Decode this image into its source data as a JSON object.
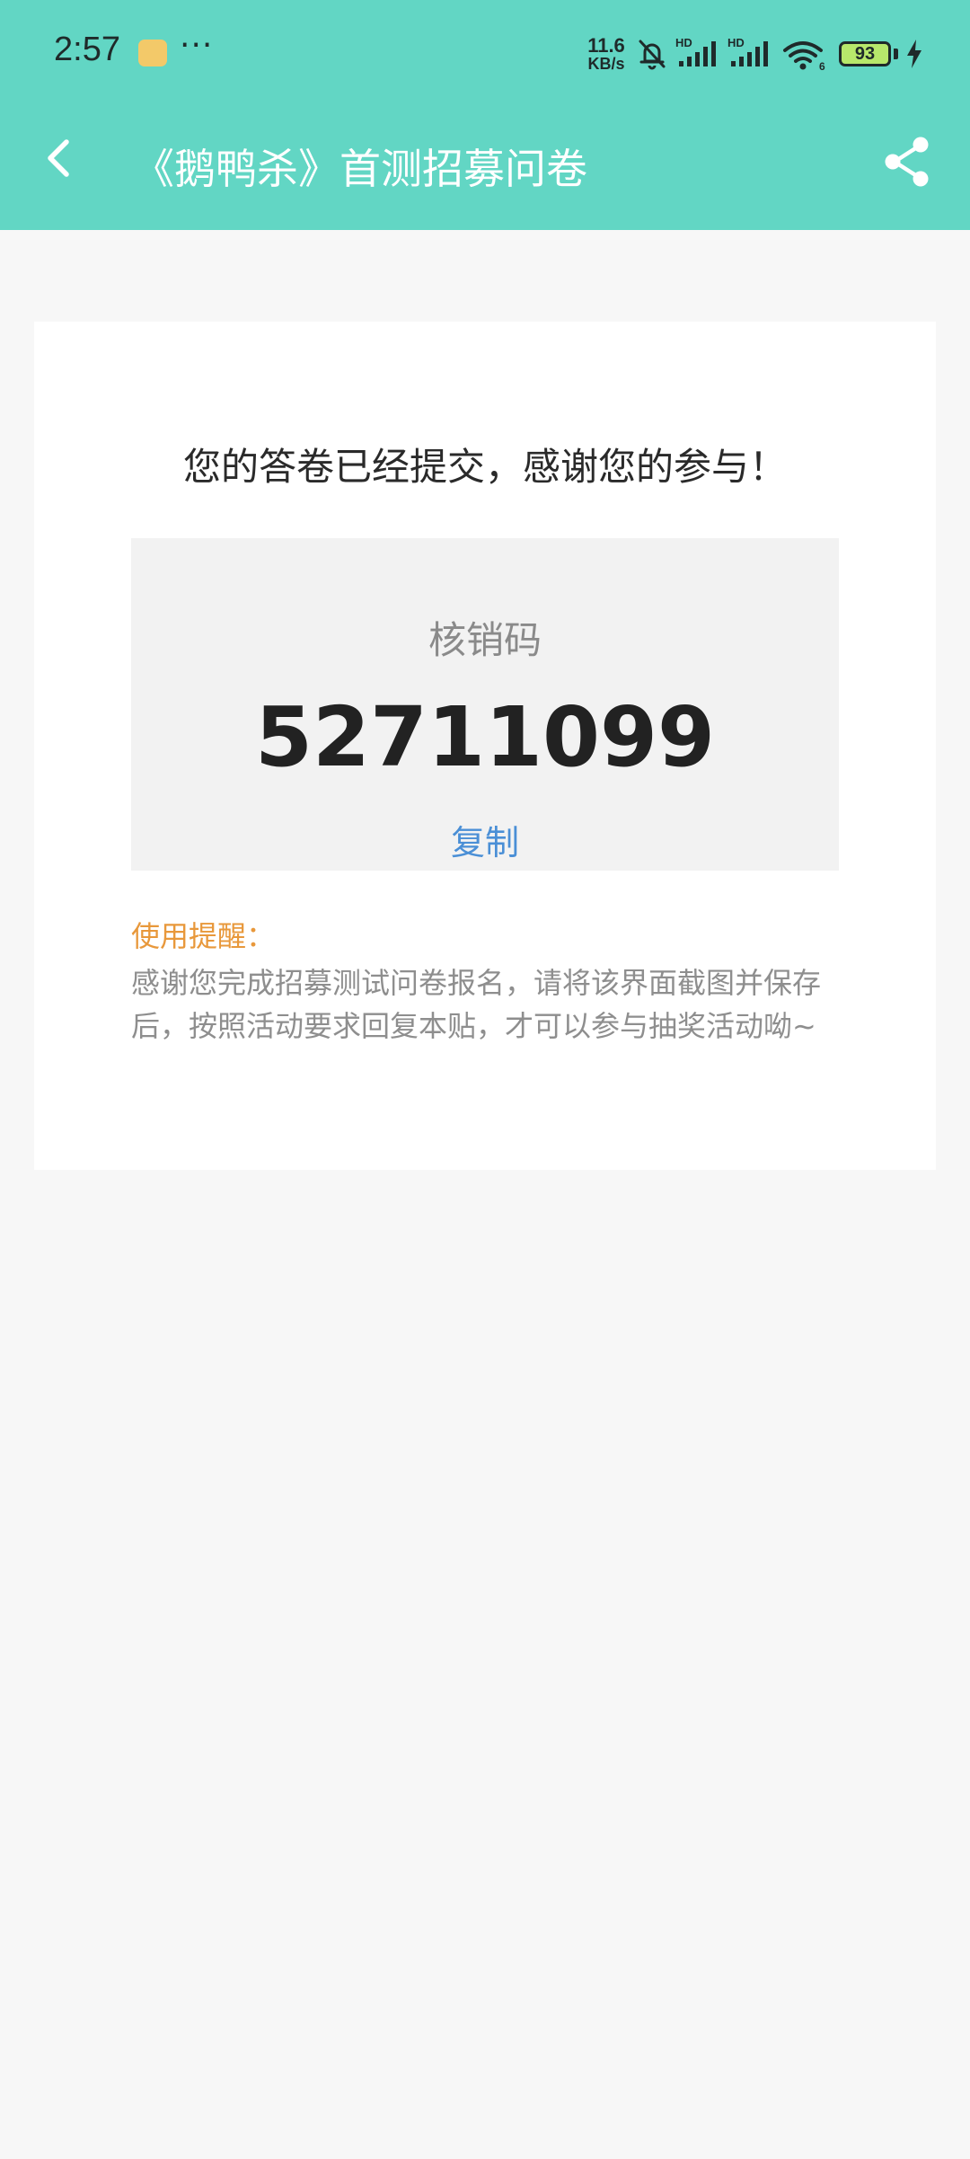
{
  "status_bar": {
    "time": "2:57",
    "more_indicator": "···",
    "net_speed_value": "11.6",
    "net_speed_unit": "KB/s",
    "battery_level": "93",
    "icons": [
      "app-notification-icon",
      "bell-muted-icon",
      "hd-signal-icon",
      "hd-signal-icon",
      "wifi-icon",
      "battery-icon",
      "charging-icon"
    ]
  },
  "nav": {
    "title": "《鹅鸭杀》首测招募问卷",
    "back_icon": "chevron-left-icon",
    "share_icon": "share-icon"
  },
  "card": {
    "confirm_message": "您的答卷已经提交，感谢您的参与！",
    "code_label": "核销码",
    "code_value": "52711099",
    "copy_label": "复制",
    "tip_title": "使用提醒：",
    "tip_body": "感谢您完成招募测试问卷报名，请将该界面截图并保存后，按照活动要求回复本贴，才可以参与抽奖活动呦~"
  },
  "colors": {
    "header": "#62d6c4",
    "page_background": "#f7f7f7",
    "link": "#4a8fd6",
    "tip_title": "#e8983b"
  }
}
